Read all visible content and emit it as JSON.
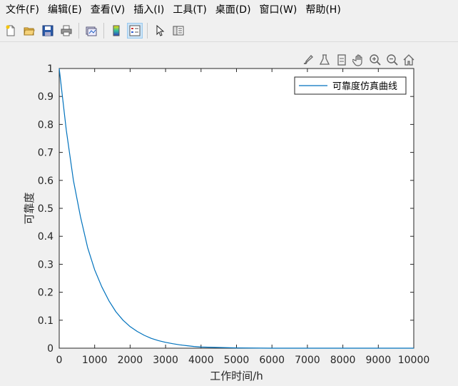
{
  "menu": [
    "文件(F)",
    "编辑(E)",
    "查看(V)",
    "插入(I)",
    "工具(T)",
    "桌面(D)",
    "窗口(W)",
    "帮助(H)"
  ],
  "toolbar_icons": [
    "new-file-icon",
    "open-folder-icon",
    "save-icon",
    "print-icon",
    "link-plot-icon",
    "colorbar-icon",
    "legend-icon",
    "pointer-icon",
    "property-editor-icon"
  ],
  "axes_toolbar_icons": [
    "brush-icon",
    "data-tips-icon",
    "rotate-icon",
    "pan-hand-icon",
    "zoom-in-icon",
    "zoom-out-icon",
    "home-icon"
  ],
  "colors": {
    "line": "#0072bd",
    "axes_bg": "#ffffff",
    "figure_bg": "#f0f0f0"
  },
  "chart_data": {
    "type": "line",
    "xlabel": "工作时间/h",
    "ylabel": "可靠度",
    "xlim": [
      0,
      10000
    ],
    "ylim": [
      0,
      1
    ],
    "xticks": [
      "0",
      "1000",
      "2000",
      "3000",
      "4000",
      "5000",
      "6000",
      "7000",
      "8000",
      "9000",
      "10000"
    ],
    "yticks": [
      "0",
      "0.1",
      "0.2",
      "0.3",
      "0.4",
      "0.5",
      "0.6",
      "0.7",
      "0.8",
      "0.9",
      "1"
    ],
    "grid": false,
    "legend_position": "top-right",
    "series": [
      {
        "name": "可靠度仿真曲线",
        "x": [
          0,
          200,
          400,
          600,
          800,
          1000,
          1200,
          1400,
          1600,
          1800,
          2000,
          2200,
          2400,
          2600,
          2800,
          3000,
          3200,
          3400,
          3600,
          3800,
          4000,
          5000,
          6000,
          7000,
          8000,
          9000,
          10000
        ],
        "y": [
          1.0,
          0.78,
          0.6,
          0.47,
          0.36,
          0.28,
          0.22,
          0.17,
          0.13,
          0.1,
          0.077,
          0.06,
          0.046,
          0.035,
          0.027,
          0.021,
          0.016,
          0.012,
          0.009,
          0.006,
          0.004,
          0.001,
          0.0,
          0.0,
          0.0,
          0.0,
          0.0
        ]
      }
    ]
  }
}
